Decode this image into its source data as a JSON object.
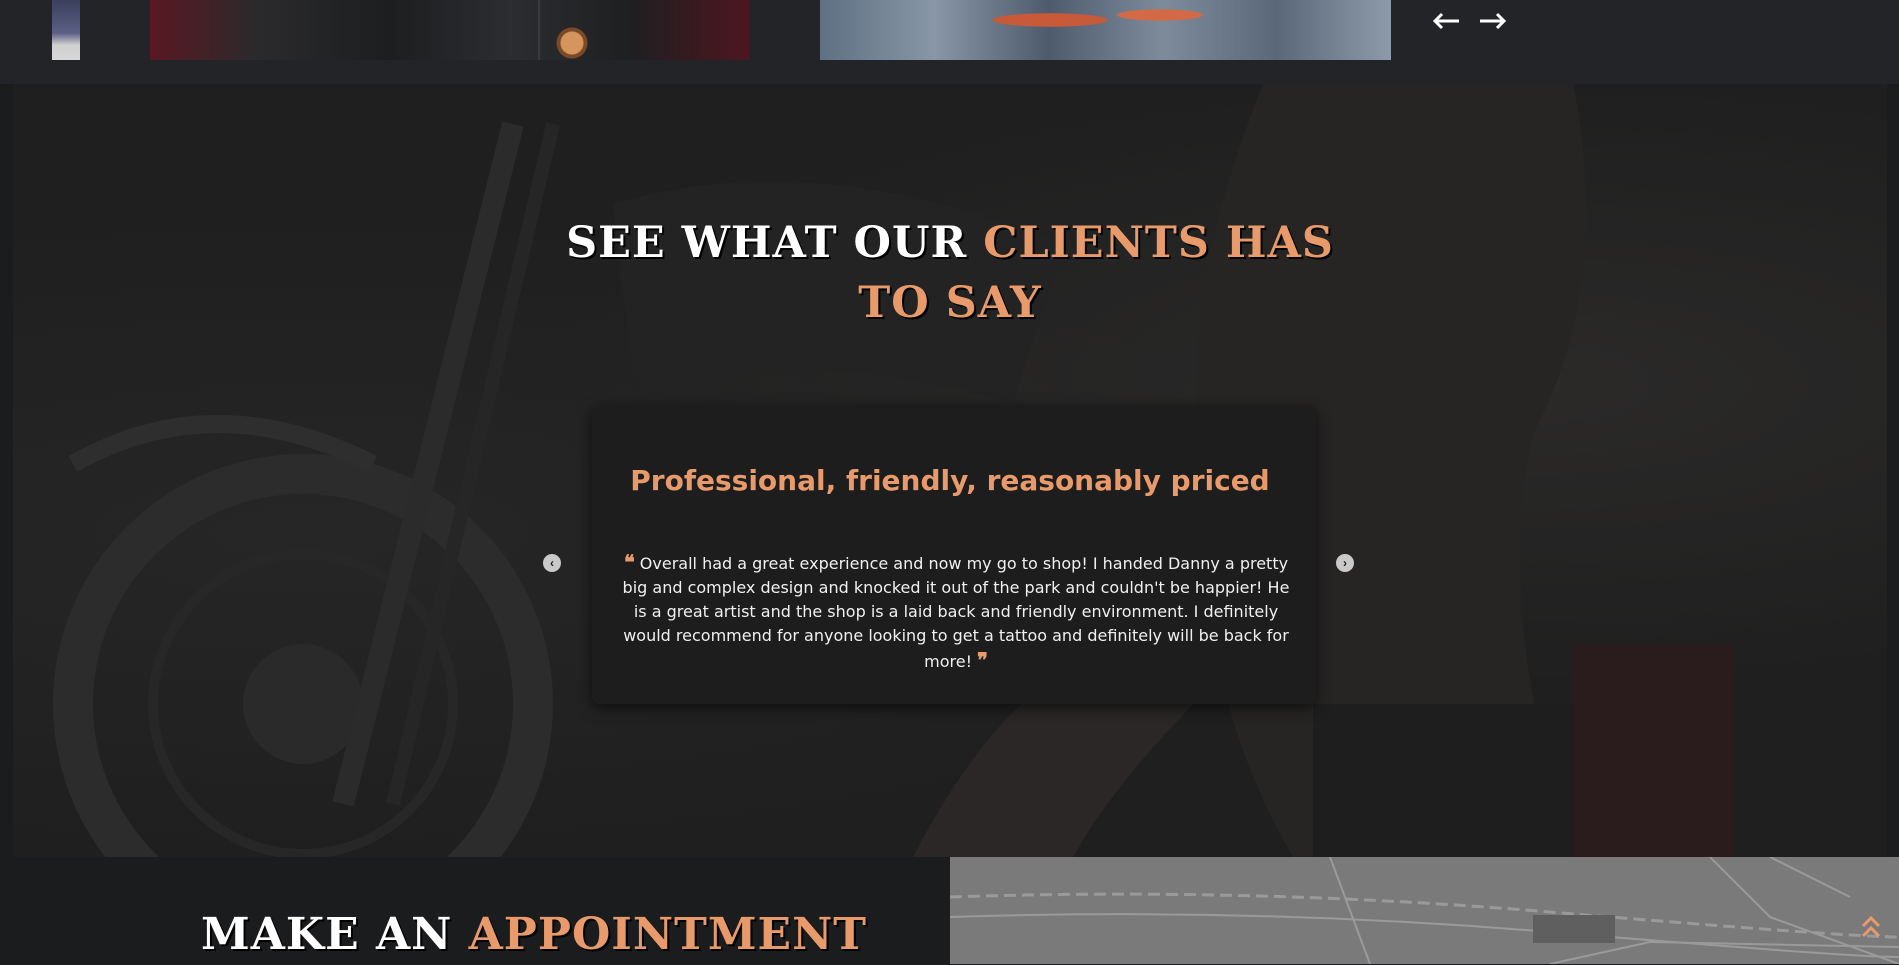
{
  "gallery": {
    "prev_label": "←",
    "next_label": "→"
  },
  "testimonials": {
    "title_white": "SEE WHAT OUR",
    "title_accent_1": "CLIENTS HAS",
    "title_accent_2": "TO SAY",
    "card_title": "Professional, friendly, reasonably priced",
    "open_quote": "❝",
    "close_quote": "❞",
    "quote_text": "Overall had a great experience and now my go to shop! I handed Danny a pretty big and complex design and knocked it out of the park and couldn't be happier! He is a great artist and the shop is a laid back and friendly environment. I definitely would recommend for anyone looking to get a tattoo and definitely will be back for more!",
    "prev_icon": "‹",
    "next_icon": "›"
  },
  "appointment": {
    "title_white": "MAKE AN",
    "title_accent": "APPOINTMENT"
  },
  "icons": {
    "prev": "arrow-left-icon",
    "next": "arrow-right-icon",
    "scroll_top": "double-chevron-up-icon"
  },
  "colors": {
    "accent": "#e89a6a",
    "background": "#1b1c1e",
    "card": "#1d1d1e"
  }
}
